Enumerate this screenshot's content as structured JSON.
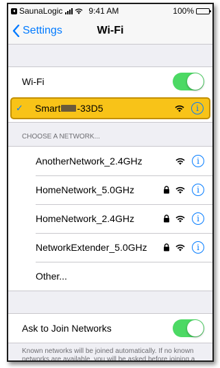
{
  "status_bar": {
    "app_name": "SaunaLogic",
    "time": "9:41 AM",
    "battery": "100%",
    "battery_level": 1.0
  },
  "nav": {
    "back_label": "Settings",
    "title": "Wi-Fi"
  },
  "wifi_toggle": {
    "label": "Wi-Fi",
    "on": true
  },
  "connected_network": {
    "name_prefix": "Smart",
    "name_suffix": "-33D5",
    "checked": true,
    "highlight_color": "#f8c318"
  },
  "choose_header": "CHOOSE A NETWORK...",
  "networks": [
    {
      "name": "AnotherNetwork_2.4GHz",
      "locked": false
    },
    {
      "name": "HomeNetwork_5.0GHz",
      "locked": true
    },
    {
      "name": "HomeNetwork_2.4GHz",
      "locked": true
    },
    {
      "name": "NetworkExtender_5.0GHz",
      "locked": true
    },
    {
      "name": "Other...",
      "locked": false,
      "other": true
    }
  ],
  "ask_to_join": {
    "label": "Ask to Join Networks",
    "on": true,
    "note": "Known networks will be joined automatically. If no known networks are available, you will be asked before joining a new network."
  },
  "colors": {
    "accent": "#007aff",
    "toggle_on": "#4cd964"
  }
}
